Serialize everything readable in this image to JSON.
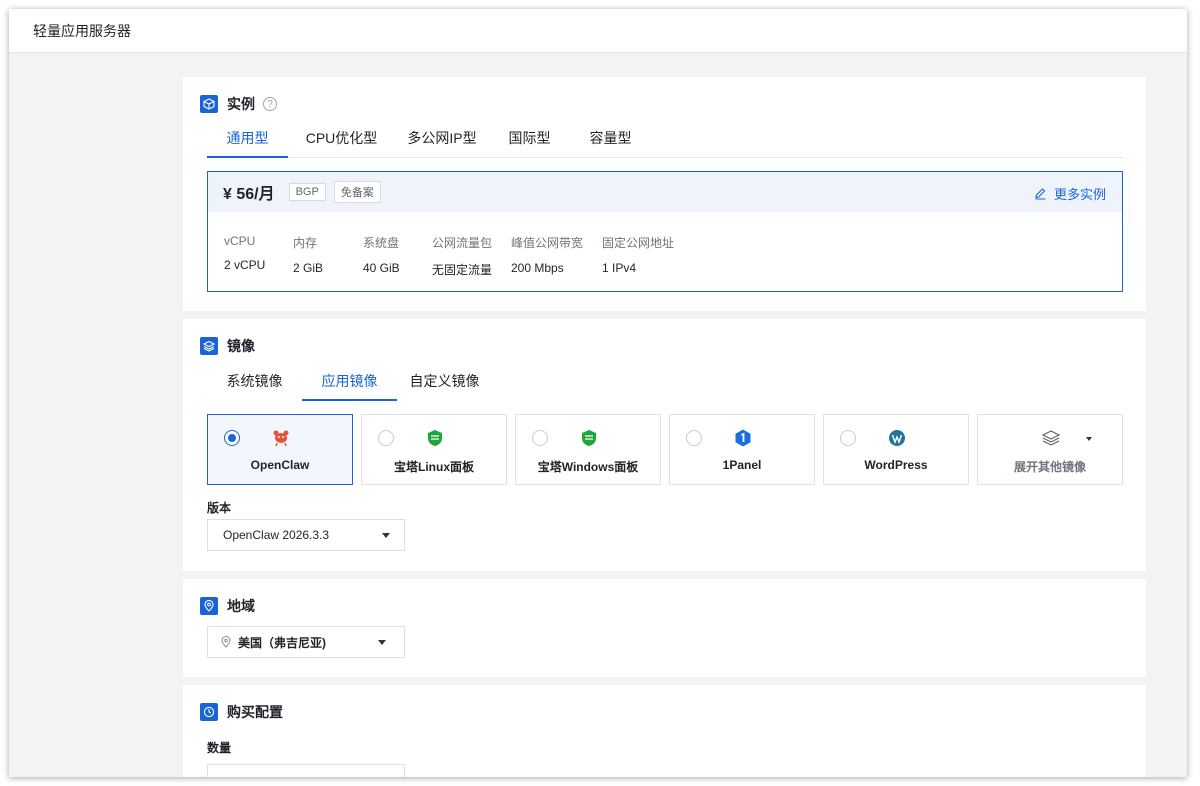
{
  "header": {
    "title": "轻量应用服务器"
  },
  "instance": {
    "title": "实例",
    "help": "?",
    "tabs": [
      "通用型",
      "CPU优化型",
      "多公网IP型",
      "国际型",
      "容量型"
    ],
    "active_tab": 0,
    "card": {
      "price": "¥ 56/月",
      "chips": [
        "BGP",
        "免备案"
      ],
      "more_link": "更多实例",
      "specs": [
        {
          "label": "vCPU",
          "value": "2 vCPU"
        },
        {
          "label": "内存",
          "value": "2 GiB"
        },
        {
          "label": "系统盘",
          "value": "40 GiB"
        },
        {
          "label": "公网流量包",
          "value": "无固定流量"
        },
        {
          "label": "峰值公网带宽",
          "value": "200 Mbps"
        },
        {
          "label": "固定公网地址",
          "value": "1 IPv4"
        }
      ]
    }
  },
  "image": {
    "title": "镜像",
    "tabs": [
      "系统镜像",
      "应用镜像",
      "自定义镜像"
    ],
    "active_tab": 1,
    "options": [
      {
        "label": "OpenClaw",
        "icon": "lobster-icon",
        "selected": true
      },
      {
        "label": "宝塔Linux面板",
        "icon": "bt-panel-icon",
        "selected": false
      },
      {
        "label": "宝塔Windows面板",
        "icon": "bt-panel-icon",
        "selected": false
      },
      {
        "label": "1Panel",
        "icon": "1panel-icon",
        "selected": false
      },
      {
        "label": "WordPress",
        "icon": "wordpress-icon",
        "selected": false
      }
    ],
    "expand_label": "展开其他镜像",
    "version_label": "版本",
    "version_value": "OpenClaw 2026.3.3"
  },
  "region": {
    "title": "地域",
    "value": "美国（弗吉尼亚)"
  },
  "purchase": {
    "title": "购买配置",
    "quantity_label": "数量"
  },
  "colors": {
    "accent": "#1a64d8",
    "background": "#f2f3f5",
    "bt_green": "#20a53a"
  }
}
